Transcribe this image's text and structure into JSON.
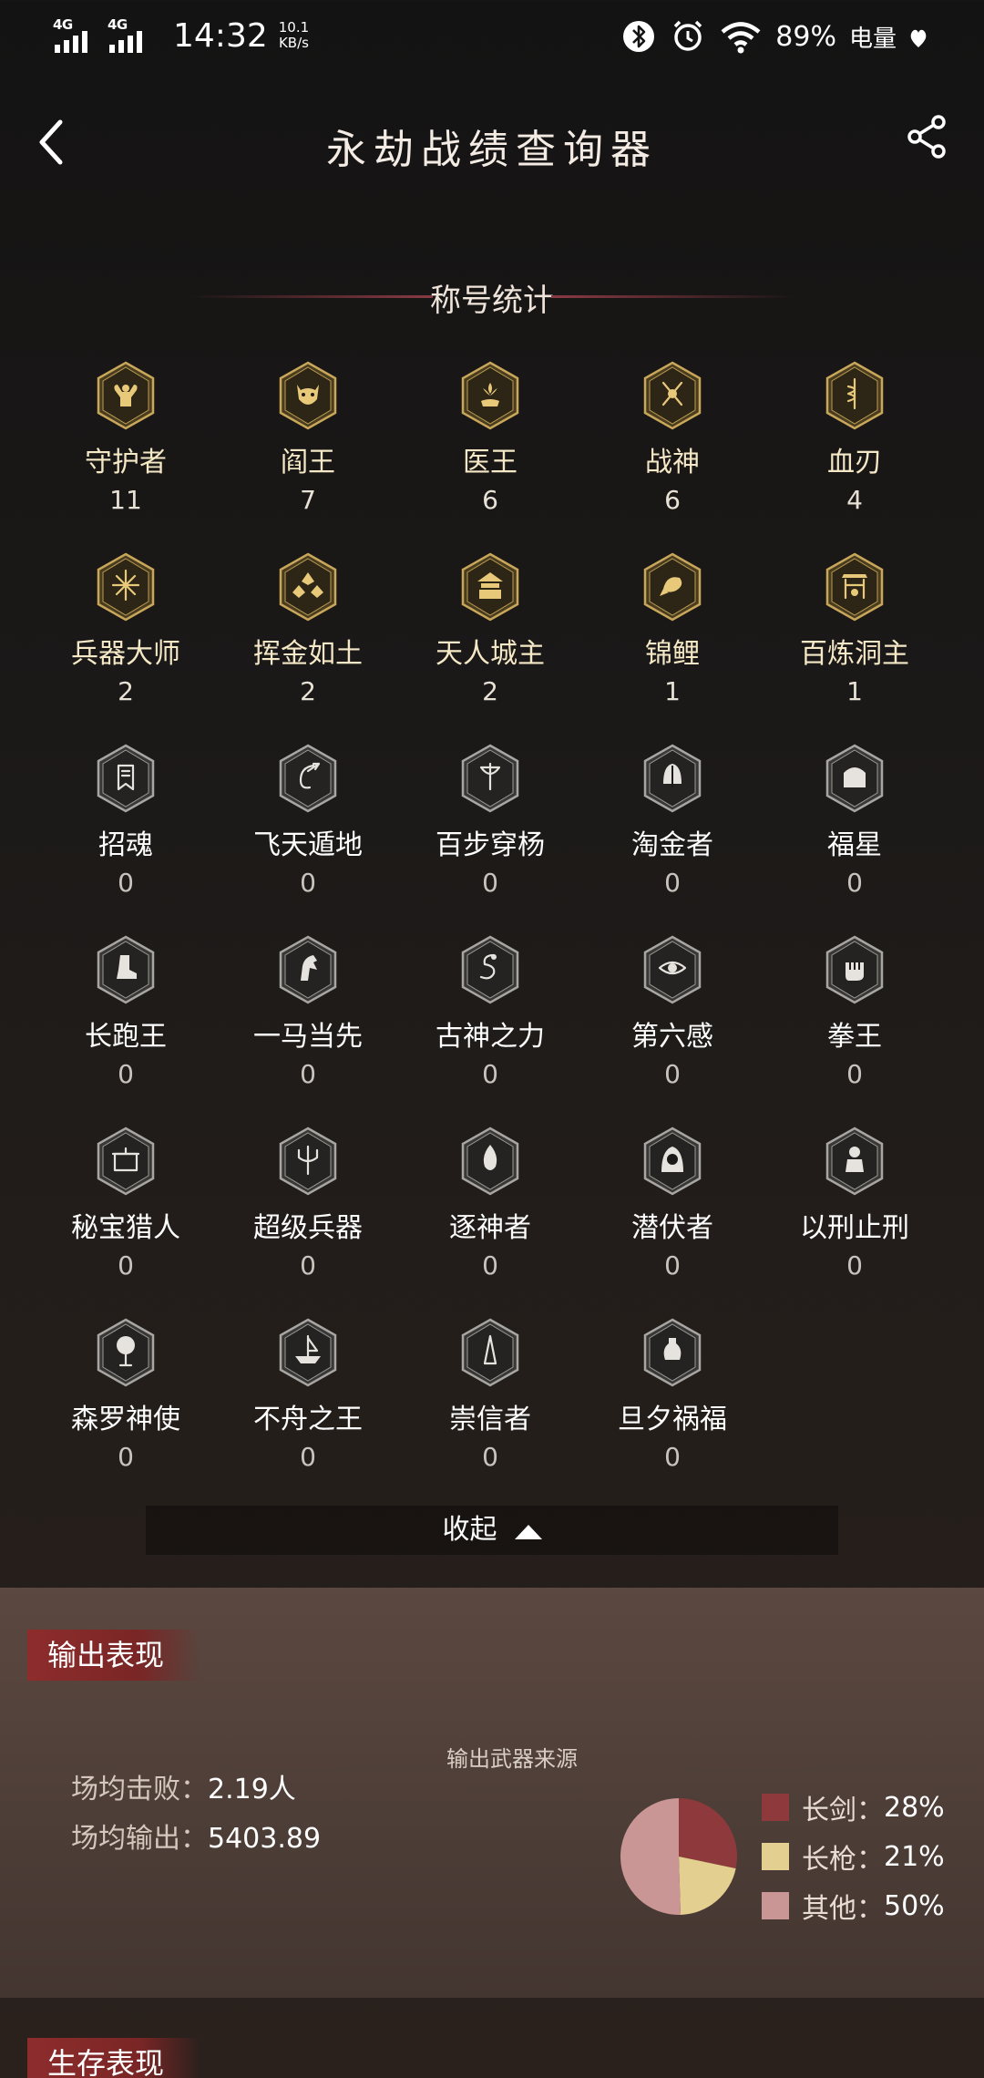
{
  "status_bar": {
    "net1": "4G",
    "net2": "4G",
    "time": "14:32",
    "speed_value": "10.1",
    "speed_unit": "KB/s",
    "battery": "89%",
    "battery_label": "电量"
  },
  "header": {
    "title": "永劫战绩查询器"
  },
  "titles_section": {
    "heading": "称号统计",
    "items": [
      {
        "name": "守护者",
        "count": "11",
        "icon": "muscle-man-icon",
        "gold": true
      },
      {
        "name": "阎王",
        "count": "7",
        "icon": "demon-mask-icon",
        "gold": true
      },
      {
        "name": "医王",
        "count": "6",
        "icon": "lotus-hand-icon",
        "gold": true
      },
      {
        "name": "战神",
        "count": "6",
        "icon": "crossed-swords-icon",
        "gold": true
      },
      {
        "name": "血刃",
        "count": "4",
        "icon": "serpent-blade-icon",
        "gold": true
      },
      {
        "name": "兵器大师",
        "count": "2",
        "icon": "weapons-burst-icon",
        "gold": true
      },
      {
        "name": "挥金如土",
        "count": "2",
        "icon": "gold-ingots-icon",
        "gold": true
      },
      {
        "name": "天人城主",
        "count": "2",
        "icon": "palace-icon",
        "gold": true
      },
      {
        "name": "锦鲤",
        "count": "1",
        "icon": "koi-fish-icon",
        "gold": true
      },
      {
        "name": "百炼洞主",
        "count": "1",
        "icon": "forge-gate-icon",
        "gold": true
      },
      {
        "name": "招魂",
        "count": "0",
        "icon": "banner-icon",
        "gold": false
      },
      {
        "name": "飞天遁地",
        "count": "0",
        "icon": "grappling-hook-icon",
        "gold": false
      },
      {
        "name": "百步穿杨",
        "count": "0",
        "icon": "bow-icon",
        "gold": false
      },
      {
        "name": "淘金者",
        "count": "0",
        "icon": "helmet-icon",
        "gold": false
      },
      {
        "name": "福星",
        "count": "0",
        "icon": "treasure-chest-icon",
        "gold": false
      },
      {
        "name": "长跑王",
        "count": "0",
        "icon": "boot-icon",
        "gold": false
      },
      {
        "name": "一马当先",
        "count": "0",
        "icon": "horse-head-icon",
        "gold": false
      },
      {
        "name": "古神之力",
        "count": "0",
        "icon": "ancient-serpent-icon",
        "gold": false
      },
      {
        "name": "第六感",
        "count": "0",
        "icon": "third-eye-icon",
        "gold": false
      },
      {
        "name": "拳王",
        "count": "0",
        "icon": "fist-icon",
        "gold": false
      },
      {
        "name": "秘宝猎人",
        "count": "0",
        "icon": "relic-box-icon",
        "gold": false
      },
      {
        "name": "超级兵器",
        "count": "0",
        "icon": "trident-icon",
        "gold": false
      },
      {
        "name": "逐神者",
        "count": "0",
        "icon": "spirit-flame-icon",
        "gold": false
      },
      {
        "name": "潜伏者",
        "count": "0",
        "icon": "hooded-figure-icon",
        "gold": false
      },
      {
        "name": "以刑止刑",
        "count": "0",
        "icon": "judge-statue-icon",
        "gold": false
      },
      {
        "name": "森罗神使",
        "count": "0",
        "icon": "sacred-tree-icon",
        "gold": false
      },
      {
        "name": "不舟之王",
        "count": "0",
        "icon": "ship-icon",
        "gold": false
      },
      {
        "name": "崇信者",
        "count": "0",
        "icon": "praying-hands-icon",
        "gold": false
      },
      {
        "name": "旦夕祸福",
        "count": "0",
        "icon": "vase-figure-icon",
        "gold": false
      }
    ],
    "collapse_label": "收起"
  },
  "output_section": {
    "heading": "输出表现",
    "stats": [
      {
        "label": "场均击败：",
        "value": "2.19人"
      },
      {
        "label": "场均输出：",
        "value": "5403.89"
      }
    ],
    "chart_title": "输出武器来源"
  },
  "chart_data": {
    "type": "pie",
    "title": "输出武器来源",
    "labels": [
      "长剑",
      "长枪",
      "其他"
    ],
    "values": [
      28,
      21,
      50
    ],
    "display": [
      "28%",
      "21%",
      "50%"
    ],
    "colors": [
      "#8e3a3c",
      "#e3cf8f",
      "#c99695"
    ]
  },
  "survival_section": {
    "heading": "生存表现"
  }
}
